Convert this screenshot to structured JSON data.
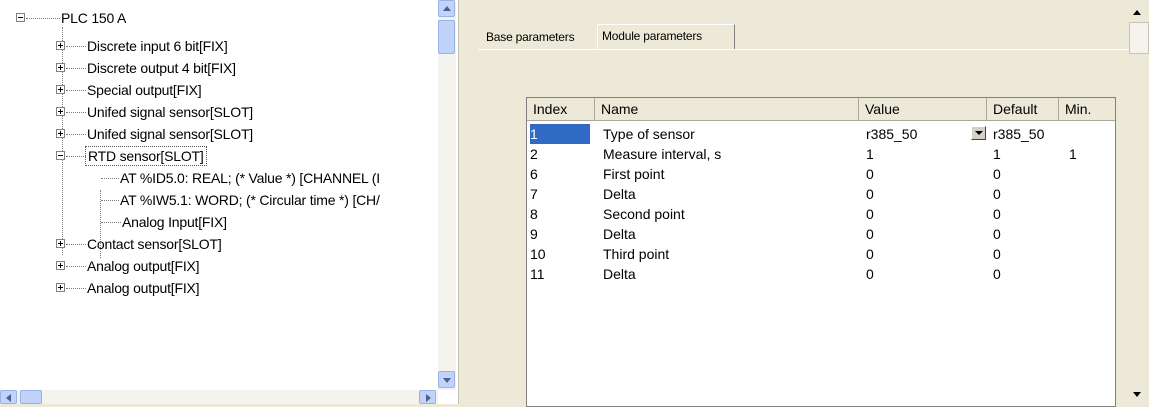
{
  "tree": {
    "root_label": "PLC 150 A",
    "items": [
      {
        "label": "Discrete input 6 bit[FIX]",
        "expander": "plus"
      },
      {
        "label": "Discrete output 4 bit[FIX]",
        "expander": "plus"
      },
      {
        "label": "Special output[FIX]",
        "expander": "plus"
      },
      {
        "label": "Unifed signal sensor[SLOT]",
        "expander": "plus"
      },
      {
        "label": "Unifed signal sensor[SLOT]",
        "expander": "plus"
      },
      {
        "label": "RTD sensor[SLOT]",
        "expander": "minus",
        "selected": true
      },
      {
        "label": "AT %ID5.0: REAL; (* Value *) [CHANNEL (I",
        "child": true
      },
      {
        "label": "AT %IW5.1: WORD; (* Circular time *) [CH/",
        "child": true
      },
      {
        "label": "Analog Input[FIX]",
        "child": true
      },
      {
        "label": "Contact sensor[SLOT]",
        "expander": "plus"
      },
      {
        "label": "Analog output[FIX]",
        "expander": "plus"
      },
      {
        "label": "Analog output[FIX]",
        "expander": "plus"
      }
    ]
  },
  "tabs": [
    {
      "label": "Base parameters",
      "active": false
    },
    {
      "label": "Module parameters",
      "active": true
    }
  ],
  "grid": {
    "columns": [
      "Index",
      "Name",
      "Value",
      "Default",
      "Min."
    ],
    "rows": [
      {
        "index": "1",
        "name": "Type of sensor",
        "value": "r385_50",
        "default": "r385_50",
        "min": "",
        "has_dropdown": true
      },
      {
        "index": "2",
        "name": "Measure interval, s",
        "value": "1",
        "default": "1",
        "min": "1"
      },
      {
        "index": "6",
        "name": "First point",
        "value": "0",
        "default": "0",
        "min": ""
      },
      {
        "index": "7",
        "name": "Delta",
        "value": "0",
        "default": "0",
        "min": ""
      },
      {
        "index": "8",
        "name": "Second point",
        "value": "0",
        "default": "0",
        "min": ""
      },
      {
        "index": "9",
        "name": "Delta",
        "value": "0",
        "default": "0",
        "min": ""
      },
      {
        "index": "10",
        "name": "Third point",
        "value": "0",
        "default": "0",
        "min": ""
      },
      {
        "index": "11",
        "name": "Delta",
        "value": "0",
        "default": "0",
        "min": ""
      }
    ]
  },
  "colors": {
    "selection": "#316ac5",
    "window_bg": "#ece9d8",
    "scrollbar_accent": "#c1d3fb"
  }
}
